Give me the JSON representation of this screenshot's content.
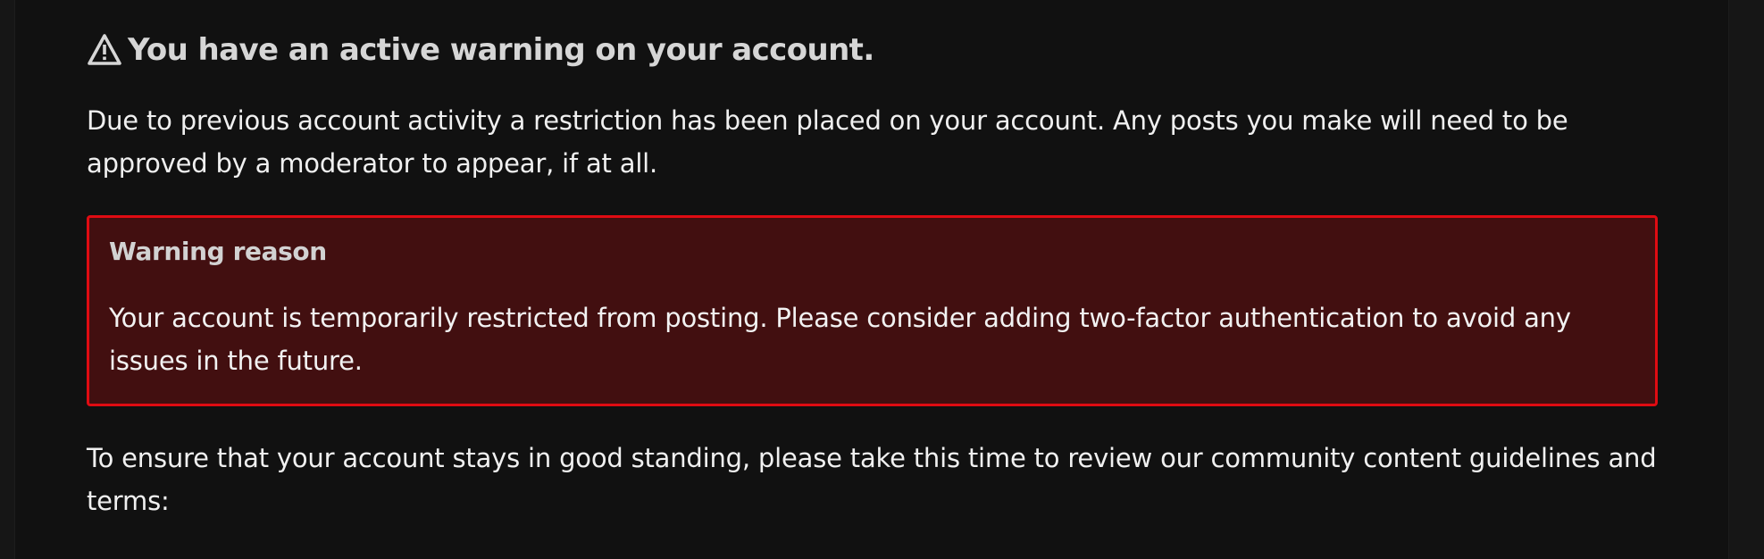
{
  "notice": {
    "heading": "You have an active warning on your account.",
    "icon": "warning-triangle-icon",
    "lead": "Due to previous account activity a restriction has been placed on your account. Any posts you make will need to be approved by a moderator to appear, if at all.",
    "warning": {
      "title": "Warning reason",
      "reason": "Your account is temporarily restricted from posting. Please consider adding two-factor authentication to avoid any issues in the future.",
      "border_color": "#e00b12",
      "background_color": "#420f10"
    },
    "footer": "To ensure that your account stays in good standing, please take this time to review our community content guidelines and terms:"
  }
}
